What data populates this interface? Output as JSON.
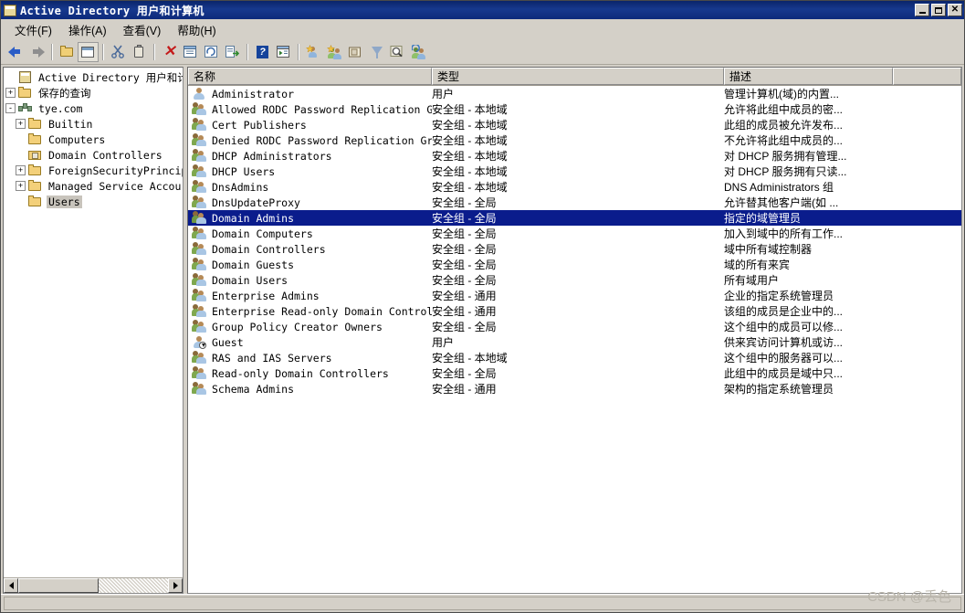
{
  "window": {
    "title": "Active Directory 用户和计算机",
    "title_icon": "console-icon",
    "buttons": {
      "minimize": "_",
      "maximize": "□",
      "close": "✕"
    }
  },
  "menu": {
    "items": [
      {
        "label": "文件(F)",
        "name": "menu-file"
      },
      {
        "label": "操作(A)",
        "name": "menu-action"
      },
      {
        "label": "查看(V)",
        "name": "menu-view"
      },
      {
        "label": "帮助(H)",
        "name": "menu-help"
      }
    ]
  },
  "toolbar": {
    "items": [
      {
        "name": "back-icon"
      },
      {
        "name": "forward-icon"
      },
      {
        "name": "up-folder-icon"
      },
      {
        "name": "show-hide-tree-icon"
      },
      {
        "name": "cut-icon"
      },
      {
        "name": "paste-icon"
      },
      {
        "name": "delete-icon"
      },
      {
        "name": "properties-icon"
      },
      {
        "name": "refresh-icon"
      },
      {
        "name": "export-list-icon"
      },
      {
        "name": "help-icon"
      },
      {
        "name": "console-window-icon"
      },
      {
        "name": "new-user-icon"
      },
      {
        "name": "new-group-icon"
      },
      {
        "name": "new-ou-icon"
      },
      {
        "name": "filter-icon"
      },
      {
        "name": "find-icon"
      },
      {
        "name": "saved-query-user-icon"
      }
    ]
  },
  "tree": {
    "nodes": [
      {
        "label": "Active Directory 用户和计算机",
        "icon": "console-root-icon",
        "expander": "",
        "indent": 0,
        "selected": false
      },
      {
        "label": "保存的查询",
        "icon": "folder-icon",
        "expander": "+",
        "indent": 1,
        "selected": false
      },
      {
        "label": "tye.com",
        "icon": "domain-icon",
        "expander": "-",
        "indent": 1,
        "selected": false
      },
      {
        "label": "Builtin",
        "icon": "folder-icon",
        "expander": "+",
        "indent": 2,
        "selected": false
      },
      {
        "label": "Computers",
        "icon": "folder-icon",
        "expander": "",
        "indent": 2,
        "selected": false
      },
      {
        "label": "Domain Controllers",
        "icon": "ou-folder-icon",
        "expander": "",
        "indent": 2,
        "selected": false
      },
      {
        "label": "ForeignSecurityPrincip",
        "icon": "folder-icon",
        "expander": "+",
        "indent": 2,
        "selected": false
      },
      {
        "label": "Managed Service Accour",
        "icon": "folder-icon",
        "expander": "+",
        "indent": 2,
        "selected": false
      },
      {
        "label": "Users",
        "icon": "folder-icon",
        "expander": "",
        "indent": 2,
        "selected": true
      }
    ]
  },
  "list": {
    "columns": [
      {
        "label": "名称",
        "name": "column-name"
      },
      {
        "label": "类型",
        "name": "column-type"
      },
      {
        "label": "描述",
        "name": "column-description"
      }
    ],
    "rows": [
      {
        "name": "Administrator",
        "type": "用户",
        "desc": "管理计算机(域)的内置...",
        "icon": "user-icon",
        "selected": false
      },
      {
        "name": "Allowed RODC Password Replication Group",
        "type": "安全组 - 本地域",
        "desc": "允许将此组中成员的密...",
        "icon": "group-icon",
        "selected": false
      },
      {
        "name": "Cert Publishers",
        "type": "安全组 - 本地域",
        "desc": "此组的成员被允许发布...",
        "icon": "group-icon",
        "selected": false
      },
      {
        "name": "Denied RODC Password Replication Group",
        "type": "安全组 - 本地域",
        "desc": "不允许将此组中成员的...",
        "icon": "group-icon",
        "selected": false
      },
      {
        "name": "DHCP Administrators",
        "type": "安全组 - 本地域",
        "desc": "对 DHCP 服务拥有管理...",
        "icon": "group-icon",
        "selected": false
      },
      {
        "name": "DHCP Users",
        "type": "安全组 - 本地域",
        "desc": "对 DHCP 服务拥有只读...",
        "icon": "group-icon",
        "selected": false
      },
      {
        "name": "DnsAdmins",
        "type": "安全组 - 本地域",
        "desc": "DNS Administrators 组",
        "icon": "group-icon",
        "selected": false
      },
      {
        "name": "DnsUpdateProxy",
        "type": "安全组 - 全局",
        "desc": "允许替其他客户端(如 ...",
        "icon": "group-icon",
        "selected": false
      },
      {
        "name": "Domain Admins",
        "type": "安全组 - 全局",
        "desc": "指定的域管理员",
        "icon": "group-icon",
        "selected": true
      },
      {
        "name": "Domain Computers",
        "type": "安全组 - 全局",
        "desc": "加入到域中的所有工作...",
        "icon": "group-icon",
        "selected": false
      },
      {
        "name": "Domain Controllers",
        "type": "安全组 - 全局",
        "desc": "域中所有域控制器",
        "icon": "group-icon",
        "selected": false
      },
      {
        "name": "Domain Guests",
        "type": "安全组 - 全局",
        "desc": "域的所有来宾",
        "icon": "group-icon",
        "selected": false
      },
      {
        "name": "Domain Users",
        "type": "安全组 - 全局",
        "desc": "所有域用户",
        "icon": "group-icon",
        "selected": false
      },
      {
        "name": "Enterprise Admins",
        "type": "安全组 - 通用",
        "desc": "企业的指定系统管理员",
        "icon": "group-icon",
        "selected": false
      },
      {
        "name": "Enterprise Read-only Domain Controllers",
        "type": "安全组 - 通用",
        "desc": "该组的成员是企业中的...",
        "icon": "group-icon",
        "selected": false
      },
      {
        "name": "Group Policy Creator Owners",
        "type": "安全组 - 全局",
        "desc": "这个组中的成员可以修...",
        "icon": "group-icon",
        "selected": false
      },
      {
        "name": "Guest",
        "type": "用户",
        "desc": "供来宾访问计算机或访...",
        "icon": "user-disabled-icon",
        "selected": false
      },
      {
        "name": "RAS and IAS Servers",
        "type": "安全组 - 本地域",
        "desc": "这个组中的服务器可以...",
        "icon": "group-icon",
        "selected": false
      },
      {
        "name": "Read-only Domain Controllers",
        "type": "安全组 - 全局",
        "desc": "此组中的成员是域中只...",
        "icon": "group-icon",
        "selected": false
      },
      {
        "name": "Schema Admins",
        "type": "安全组 - 通用",
        "desc": "架构的指定系统管理员",
        "icon": "group-icon",
        "selected": false
      }
    ]
  },
  "statusbar": {
    "watermark": "CSDN @丢色"
  },
  "colors": {
    "titlebar": "#0a246a",
    "selection": "#0a1c8c",
    "face": "#d4d0c8",
    "tree_selection": "#c8c4bc"
  }
}
